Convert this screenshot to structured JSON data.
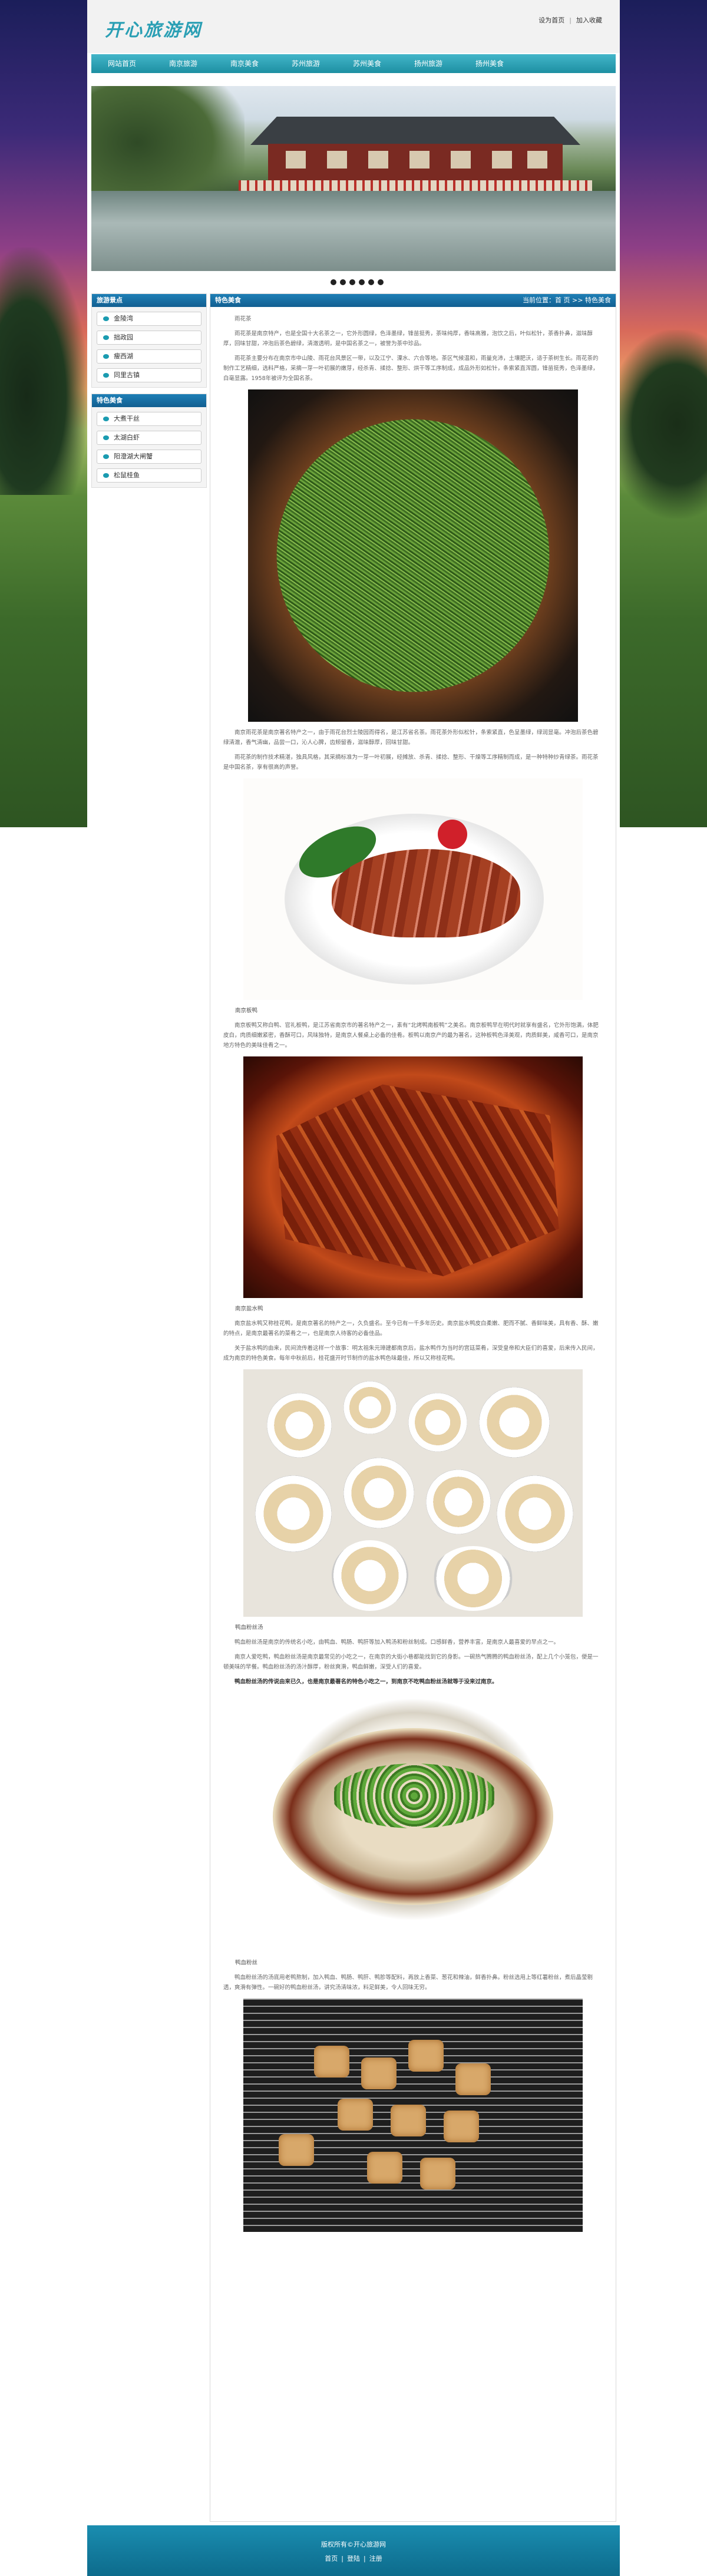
{
  "header": {
    "logo": "开心旅游网",
    "links": [
      "设为首页",
      "加入收藏"
    ]
  },
  "nav": [
    "网站首页",
    "南京旅游",
    "南京美食",
    "苏州旅游",
    "苏州美食",
    "扬州旅游",
    "扬州美食"
  ],
  "sidebar": {
    "box1": {
      "title": "旅游景点",
      "items": [
        "金陵湾",
        "拙政园",
        "瘦西湖",
        "同里古镇"
      ]
    },
    "box2": {
      "title": "特色美食",
      "items": [
        "大煮干丝",
        "太湖白虾",
        "阳澄湖大闸蟹",
        "松鼠桂鱼"
      ]
    }
  },
  "main": {
    "title": "特色美食",
    "breadcrumb": "当前位置：首 页 >> 特色美食",
    "p1": "雨花茶",
    "p2": "雨花茶是南京特产，也是全国十大名茶之一，它外形圆绿，色泽墨绿，锋苗挺秀，茶味纯厚，香味高雅，泡饮之后，叶似松针，茶香扑鼻，滋味醇厚，回味甘甜，冲泡后茶色碧绿，清澈透明，是中国名茶之一，被誉为茶中珍品。",
    "p3": "雨花茶主要分布在南京市中山陵、雨花台风景区一带，以及江宁、溧水、六合等地。茶区气候温和，雨量充沛，土壤肥沃，适于茶树生长。雨花茶的制作工艺精细，选料严格，采摘一芽一叶初展的嫩芽，经杀青、揉捻、整形、烘干等工序制成，成品外形如松针，条索紧直浑圆，锋苗挺秀，色泽墨绿，白毫显露。1958年被评为全国名茶。",
    "p4": "南京雨花茶是南京著名特产之一，由于雨花台烈士陵园而得名，是江苏省名茶。雨花茶外形似松针，条索紧直，色呈墨绿，绿润显毫。冲泡后茶色碧绿清澈，香气清幽，品尝一口，沁人心脾，齿颊留香，滋味醇厚，回味甘甜。",
    "p5": "雨花茶的制作技术精湛，独具风格，其采摘标准为一芽一叶初展，经摊放、杀青、揉捻、整形、干燥等工序精制而成，是一种特种炒青绿茶。雨花茶是中国名茶，享有很高的声誉。",
    "cap2": "南京板鸭",
    "p6": "南京板鸭又称白鸭、官礼板鸭，是江苏省南京市的著名特产之一，素有“北烤鸭南板鸭”之美名。南京板鸭早在明代时就享有盛名，它外形饱满，体肥皮白，肉质细嫩紧密，香酥可口，风味独特，是南京人餐桌上必备的佳肴。板鸭以南京产的最为著名，这种板鸭色泽美观，肉质鲜美，咸香可口，是南京地方特色的美味佳肴之一。",
    "cap3": "南京盐水鸭",
    "p7": "南京盐水鸭又称桂花鸭，是南京著名的特产之一，久负盛名。至今已有一千多年历史。南京盐水鸭皮白柔嫩、肥而不腻、香鲜味美，具有香、酥、嫩的特点，是南京最著名的菜肴之一，也是南京人待客的必备佳品。",
    "p8": "关于盐水鸭的由来，民间流传着这样一个故事：明太祖朱元璋建都南京后，盐水鸭作为当时的宫廷菜肴，深受皇帝和大臣们的喜爱，后来传入民间，成为南京的特色美食。每年中秋前后，桂花盛开时节制作的盐水鸭色味最佳，所以又称桂花鸭。",
    "cap4": "鸭血粉丝汤",
    "p9": "鸭血粉丝汤是南京的传统名小吃，由鸭血、鸭肠、鸭肝等加入鸭汤和粉丝制成。口感鲜香，营养丰富，是南京人最喜爱的早点之一。",
    "p10": "南京人爱吃鸭，鸭血粉丝汤是南京最常见的小吃之一，在南京的大街小巷都能找到它的身影。一碗热气腾腾的鸭血粉丝汤，配上几个小笼包，便是一顿美味的早餐。鸭血粉丝汤的汤汁醇厚，粉丝爽滑，鸭血鲜嫩，深受人们的喜爱。",
    "p11": "鸭血粉丝汤的传说由来已久，也是南京最著名的特色小吃之一，到南京不吃鸭血粉丝汤就等于没来过南京。",
    "cap5": "鸭血粉丝",
    "p12": "鸭血粉丝汤的汤底用老鸭熬制，加入鸭血、鸭肠、鸭肝、鸭胗等配料，再放上香菜、葱花和辣油，鲜香扑鼻。粉丝选用上等红薯粉丝，煮后晶莹剔透，爽滑有弹性。一碗好的鸭血粉丝汤，讲究汤清味浓，料足鲜美，令人回味无穷。"
  },
  "footer": {
    "line1": "版权所有©开心旅游网",
    "line2": [
      "首页",
      "登陆",
      "注册"
    ]
  }
}
